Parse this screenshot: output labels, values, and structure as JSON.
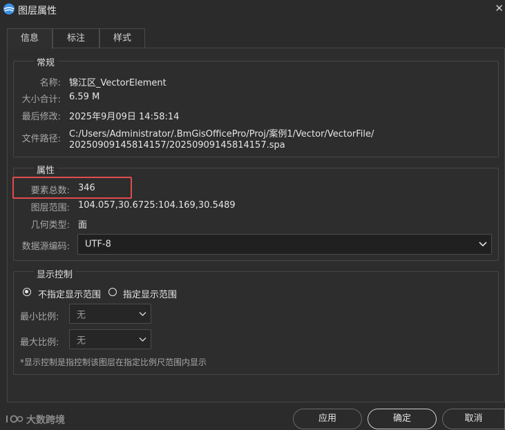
{
  "window": {
    "title": "图层属性"
  },
  "tabs": [
    {
      "label": "信息",
      "active": true
    },
    {
      "label": "标注",
      "active": false
    },
    {
      "label": "样式",
      "active": false
    }
  ],
  "general": {
    "title": "常规",
    "name_label": "名称:",
    "name_value": "锦江区_VectorElement",
    "size_label": "大小合计:",
    "size_value": "6.59 M",
    "modified_label": "最后修改:",
    "modified_value": "2025年9月09日 14:58:14",
    "path_label": "文件路径:",
    "path_line1": "C:/Users/Administrator/.BmGisOfficePro/Proj/案例1/Vector/VectorFile/",
    "path_line2": "20250909145814157/20250909145814157.spa"
  },
  "attributes": {
    "title": "属性",
    "count_label": "要素总数:",
    "count_value": "346",
    "extent_label": "图层范围:",
    "extent_value": "104.057,30.6725:104.169,30.5489",
    "geom_label": "几何类型:",
    "geom_value": "面",
    "encoding_label": "数据源编码:",
    "encoding_value": "UTF-8"
  },
  "display": {
    "title": "显示控制",
    "radio_unspecified": "不指定显示范围",
    "radio_specified": "指定显示范围",
    "selected": "unspecified",
    "min_label": "最小比例:",
    "min_value": "无",
    "max_label": "最大比例:",
    "max_value": "无",
    "note": "*显示控制是指控制该图层在指定比例尺范围内显示"
  },
  "buttons": {
    "apply": "应用",
    "ok": "确定",
    "cancel": "取消"
  },
  "watermark": {
    "text": "大数跨境"
  },
  "colors": {
    "highlight": "#e24c4c",
    "background": "#2b2b2b"
  }
}
